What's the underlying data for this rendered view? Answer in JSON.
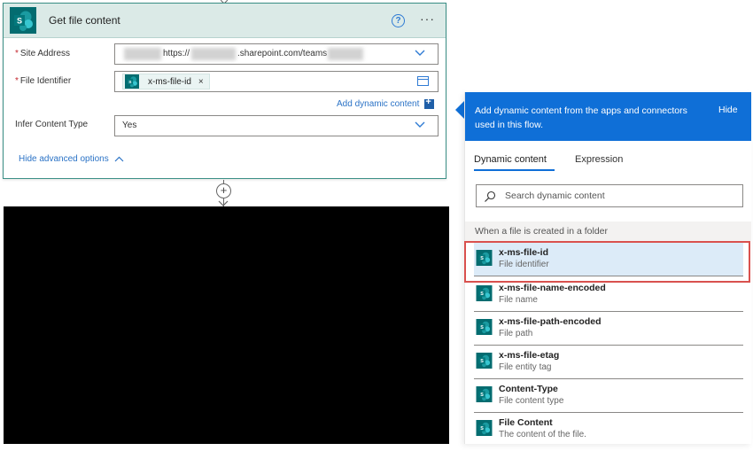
{
  "card": {
    "title": "Get file content",
    "help_glyph": "?",
    "more_glyph": "···",
    "fields": {
      "site_address": {
        "label": "Site Address",
        "url_part1": "https://",
        "url_part2": ".sharepoint.com/teams"
      },
      "file_identifier": {
        "label": "File Identifier",
        "token": "x-ms-file-id",
        "remove_glyph": "×"
      },
      "infer_content_type": {
        "label": "Infer Content Type",
        "value": "Yes"
      }
    },
    "add_dynamic_content": "Add dynamic content",
    "hide_advanced": "Hide advanced options"
  },
  "connector": {
    "plus_glyph": "+"
  },
  "panel": {
    "header_text": "Add dynamic content from the apps and connectors used in this flow.",
    "hide_label": "Hide",
    "tabs": [
      "Dynamic content",
      "Expression"
    ],
    "search_placeholder": "Search dynamic content",
    "section_title": "When a file is created in a folder",
    "items": [
      {
        "name": "x-ms-file-id",
        "desc": "File identifier"
      },
      {
        "name": "x-ms-file-name-encoded",
        "desc": "File name"
      },
      {
        "name": "x-ms-file-path-encoded",
        "desc": "File path"
      },
      {
        "name": "x-ms-file-etag",
        "desc": "File entity tag"
      },
      {
        "name": "Content-Type",
        "desc": "File content type"
      },
      {
        "name": "File Content",
        "desc": "The content of the file."
      }
    ]
  },
  "colors": {
    "panel_blue": "#0f6fd7",
    "sharepoint_teal": "#036c70",
    "highlight_red": "#d9514e",
    "link_blue": "#2b73c6"
  },
  "icons": {
    "card": "sharepoint-logo-icon",
    "help": "help-circle-icon",
    "more": "more-options-icon",
    "dropdown": "chevron-down-icon",
    "expand": "expand-icon",
    "add": "add-dynamic-icon",
    "collapse": "chevron-up-icon",
    "search": "search-icon"
  }
}
